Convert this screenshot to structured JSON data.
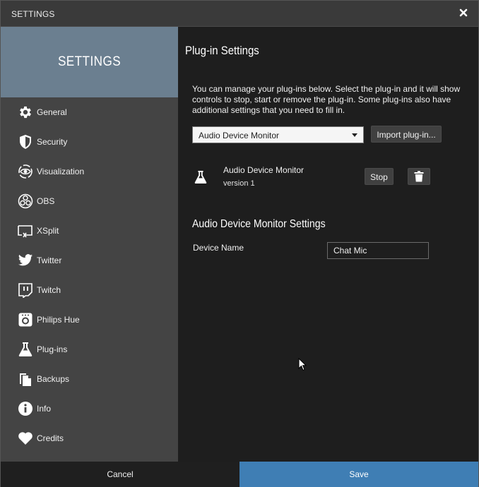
{
  "window": {
    "title": "SETTINGS",
    "close_icon": "close-icon"
  },
  "sidebar": {
    "header": "SETTINGS",
    "items": [
      {
        "label": "General",
        "icon": "gear-icon"
      },
      {
        "label": "Security",
        "icon": "shield-icon"
      },
      {
        "label": "Visualization",
        "icon": "eye-icon"
      },
      {
        "label": "OBS",
        "icon": "obs-icon"
      },
      {
        "label": "XSplit",
        "icon": "xsplit-icon"
      },
      {
        "label": "Twitter",
        "icon": "twitter-icon"
      },
      {
        "label": "Twitch",
        "icon": "twitch-icon"
      },
      {
        "label": "Philips Hue",
        "icon": "hue-bridge-icon"
      },
      {
        "label": "Plug-ins",
        "icon": "flask-icon"
      },
      {
        "label": "Backups",
        "icon": "copy-icon"
      },
      {
        "label": "Info",
        "icon": "info-icon"
      },
      {
        "label": "Credits",
        "icon": "heart-icon"
      }
    ],
    "header_color": "#6b7f90"
  },
  "content": {
    "title": "Plug-in Settings",
    "description": "You can manage your plug-ins below. Select the plug-in and it will show controls to stop, start or remove the plug-in. Some plug-ins also have additional settings that you need to fill in.",
    "plugin_select": {
      "selected": "Audio Device Monitor"
    },
    "import_button": "Import plug-in...",
    "plugin": {
      "name": "Audio Device Monitor",
      "version": "version 1",
      "stop_button": "Stop"
    },
    "settings_title": "Audio Device Monitor Settings",
    "fields": {
      "device_name_label": "Device Name",
      "device_name_value": "Chat Mic"
    }
  },
  "footer": {
    "cancel": "Cancel",
    "save": "Save",
    "save_color": "#3f7eb4"
  }
}
